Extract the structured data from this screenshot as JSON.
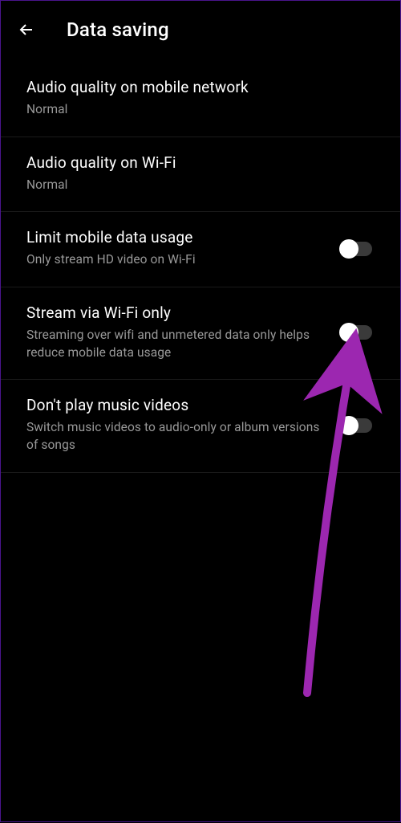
{
  "header": {
    "title": "Data saving"
  },
  "settings": [
    {
      "title": "Audio quality on mobile network",
      "subtitle": "Normal",
      "has_toggle": false
    },
    {
      "title": "Audio quality on Wi-Fi",
      "subtitle": "Normal",
      "has_toggle": false
    },
    {
      "title": "Limit mobile data usage",
      "subtitle": "Only stream HD video on Wi-Fi",
      "has_toggle": true,
      "toggle_on": false
    },
    {
      "title": "Stream via Wi-Fi only",
      "subtitle": "Streaming over wifi and unmetered data only helps reduce mobile data usage",
      "has_toggle": true,
      "toggle_on": false
    },
    {
      "title": "Don't play music videos",
      "subtitle": "Switch music videos to audio-only or album versions of songs",
      "has_toggle": true,
      "toggle_on": false
    }
  ],
  "annotation": {
    "color": "#9c27b0"
  }
}
